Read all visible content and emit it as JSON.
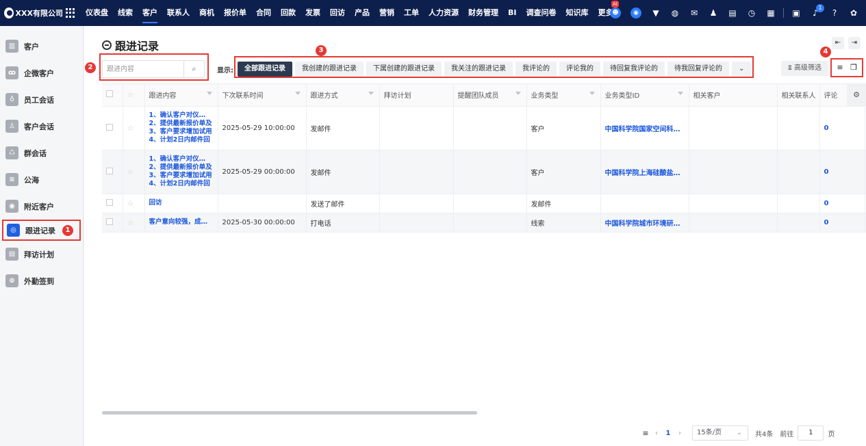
{
  "brand": {
    "name": "XXX有限公司"
  },
  "nav": {
    "items": [
      "仪表盘",
      "线索",
      "客户",
      "联系人",
      "商机",
      "报价单",
      "合同",
      "回款",
      "发票",
      "回访",
      "产品",
      "营销",
      "工单",
      "人力资源",
      "财务管理",
      "BI",
      "调查问卷",
      "知识库",
      "更多"
    ],
    "active": "客户",
    "ai_badge": "AI",
    "notification_count": "1"
  },
  "sidebar": {
    "items": [
      {
        "label": "客户",
        "icon": "customer-icon"
      },
      {
        "label": "企微客户",
        "icon": "wecom-customer-icon"
      },
      {
        "label": "员工会话",
        "icon": "employee-chat-icon"
      },
      {
        "label": "客户会话",
        "icon": "customer-chat-icon"
      },
      {
        "label": "群会话",
        "icon": "group-chat-icon"
      },
      {
        "label": "公海",
        "icon": "sea-icon"
      },
      {
        "label": "附近客户",
        "icon": "location-icon"
      },
      {
        "label": "跟进记录",
        "icon": "follow-up-icon",
        "active": true
      },
      {
        "label": "拜访计划",
        "icon": "visit-plan-icon"
      },
      {
        "label": "外勤签到",
        "icon": "checkin-icon"
      }
    ]
  },
  "markers": [
    "1",
    "2",
    "3",
    "4"
  ],
  "page": {
    "title": "跟进记录"
  },
  "search": {
    "placeholder": "跟进内容"
  },
  "filter": {
    "label": "显示:",
    "tabs": [
      "全部跟进记录",
      "我创建的跟进记录",
      "下属创建的跟进记录",
      "我关注的跟进记录",
      "我评论的",
      "评论我的",
      "待回复我评论的",
      "待我回复评论的"
    ],
    "active_index": 0,
    "advanced": "高级筛选"
  },
  "table": {
    "columns": [
      "跟进内容",
      "下次联系时间",
      "跟进方式",
      "拜访计划",
      "提醒团队成员",
      "业务类型",
      "业务类型ID",
      "相关客户",
      "相关联系人",
      "评论"
    ],
    "rows": [
      {
        "content": [
          "1、确认客户对仪…",
          "2、提供最新报价单及",
          "3、客户要求增加试用",
          "4、计划2日内邮件回"
        ],
        "next_time": "2025-05-29 10:00:00",
        "method": "发邮件",
        "visit_plan": "",
        "remind": "",
        "biz_type": "客户",
        "biz_id": "中国科学院国家空间科…",
        "customer": "",
        "contact": "",
        "comments": "0"
      },
      {
        "content": [
          "1、确认客户对仪…",
          "2、提供最新报价单及",
          "3、客户要求增加试用",
          "4、计划2日内邮件回"
        ],
        "next_time": "2025-05-29 00:00:00",
        "method": "发邮件",
        "visit_plan": "",
        "remind": "",
        "biz_type": "客户",
        "biz_id": "中国科学院上海硅酸盐…",
        "customer": "",
        "contact": "",
        "comments": "0"
      },
      {
        "content": [
          "回访"
        ],
        "next_time": "",
        "method": "发送了邮件",
        "visit_plan": "",
        "remind": "",
        "biz_type": "发邮件",
        "biz_id": "",
        "customer": "",
        "contact": "",
        "comments": "0"
      },
      {
        "content": [
          "客户意向较强，成…"
        ],
        "next_time": "2025-05-30 00:00:00",
        "method": "打电话",
        "visit_plan": "",
        "remind": "",
        "biz_type": "线索",
        "biz_id": "中国科学院城市环境研…",
        "customer": "",
        "contact": "",
        "comments": "0"
      }
    ]
  },
  "pagination": {
    "current": "1",
    "page_size": "15条/页",
    "total": "共4条",
    "goto_label": "前往",
    "goto_value": "1",
    "page_suffix": "页"
  }
}
